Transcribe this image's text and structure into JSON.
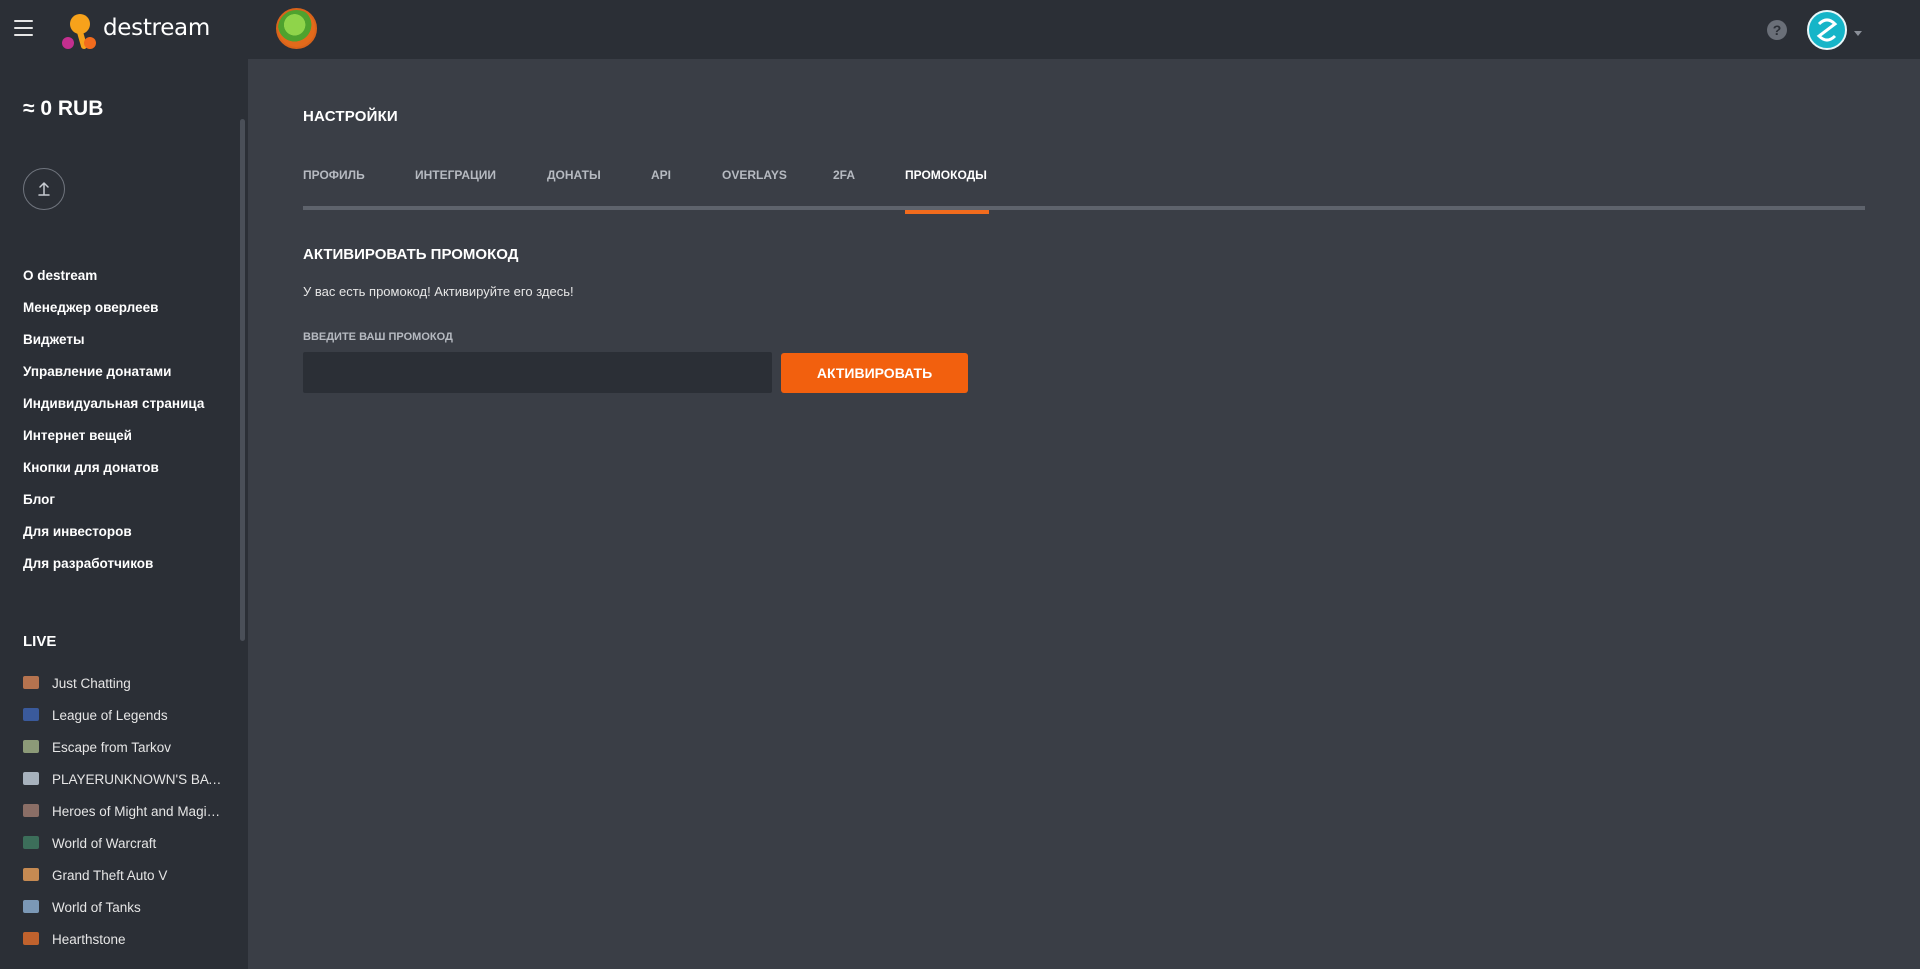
{
  "header": {
    "brand": "destream",
    "help_symbol": "?",
    "icons": {
      "menu": "hamburger-menu-icon",
      "help": "question-circle-icon",
      "dropdown": "chevron-down-icon"
    }
  },
  "sidebar": {
    "balance": "≈ 0 RUB",
    "nav": [
      "О destream",
      "Менеджер оверлеев",
      "Виджеты",
      "Управление донатами",
      "Индивидуальная страница",
      "Интернет вещей",
      "Кнопки для донатов",
      "Блог",
      "Для инвесторов",
      "Для разработчиков"
    ],
    "live_title": "LIVE",
    "live": [
      {
        "name": "Just Chatting",
        "color": "#b5734f"
      },
      {
        "name": "League of Legends",
        "color": "#3a5a9c"
      },
      {
        "name": "Escape from Tarkov",
        "color": "#8c9a78"
      },
      {
        "name": "PLAYERUNKNOWN'S BATTLEGROUNDS",
        "color": "#a7b2bd"
      },
      {
        "name": "Heroes of Might and Magic III",
        "color": "#8a6e66"
      },
      {
        "name": "World of Warcraft",
        "color": "#3c6e5a"
      },
      {
        "name": "Grand Theft Auto V",
        "color": "#c58a52"
      },
      {
        "name": "World of Tanks",
        "color": "#7b98b6"
      },
      {
        "name": "Hearthstone",
        "color": "#c0622d"
      }
    ]
  },
  "main": {
    "title": "НАСТРОЙКИ",
    "tabs": [
      {
        "label": "ПРОФИЛЬ"
      },
      {
        "label": "ИНТЕГРАЦИИ"
      },
      {
        "label": "ДОНАТЫ"
      },
      {
        "label": "API"
      },
      {
        "label": "OVERLAYS"
      },
      {
        "label": "2FA"
      },
      {
        "label": "ПРОМОКОДЫ",
        "active": true
      }
    ],
    "section_title": "АКТИВИРОВАТЬ ПРОМОКОД",
    "section_desc": "У вас есть промокод! Активируйте его здесь!",
    "field_label": "ВВЕДИТЕ ВАШ ПРОМОКОД",
    "promo_value": "",
    "activate_label": "АКТИВИРОВАТЬ"
  },
  "colors": {
    "accent": "#f2600e",
    "background": "#3a3e46",
    "panel": "#2b2f36"
  }
}
